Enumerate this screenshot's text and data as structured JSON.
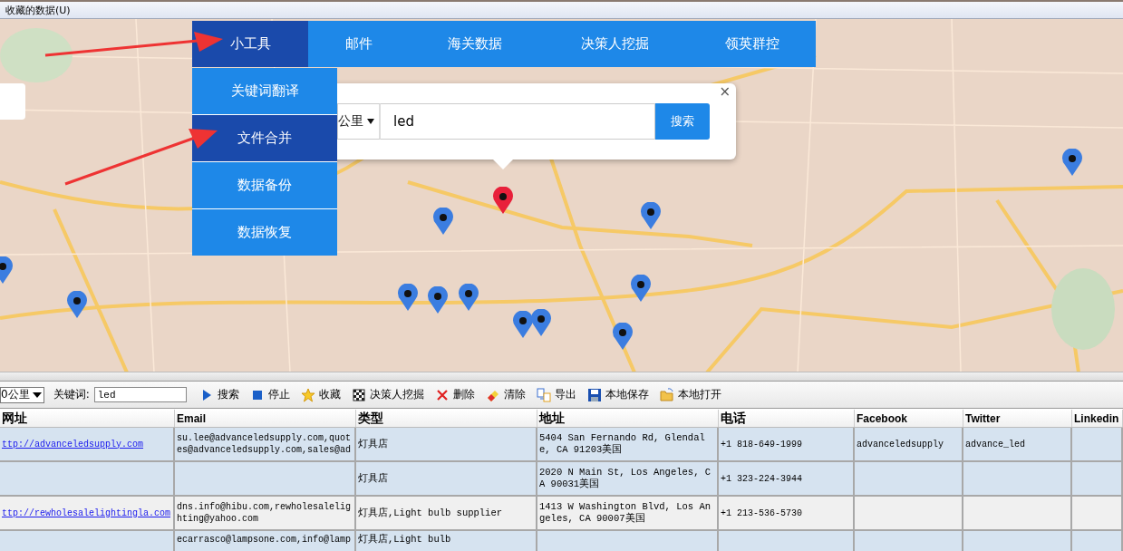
{
  "menu_bar": {
    "title": "收藏的数据(U)"
  },
  "nav_tabs": [
    {
      "label": "小工具",
      "selected": true
    },
    {
      "label": "邮件",
      "selected": false
    },
    {
      "label": "海关数据",
      "selected": false
    },
    {
      "label": "决策人挖掘",
      "selected": false
    },
    {
      "label": "领英群控",
      "selected": false
    }
  ],
  "tool_menu": [
    {
      "label": "关键词翻译",
      "selected": false
    },
    {
      "label": "文件合并",
      "selected": true
    },
    {
      "label": "数据备份",
      "selected": false
    },
    {
      "label": "数据恢复",
      "selected": false
    }
  ],
  "map_popup": {
    "distance": "公里",
    "keyword": "led",
    "search_button": "搜索",
    "close": "×"
  },
  "map_markers": [
    {
      "color": "#e8203a"
    },
    {
      "color": "#3b7de0"
    },
    {
      "color": "#3b7de0"
    },
    {
      "color": "#3b7de0"
    },
    {
      "color": "#3b7de0"
    },
    {
      "color": "#3b7de0"
    },
    {
      "color": "#3b7de0"
    },
    {
      "color": "#3b7de0"
    },
    {
      "color": "#3b7de0"
    },
    {
      "color": "#3b7de0"
    },
    {
      "color": "#3b7de0"
    },
    {
      "color": "#3b7de0"
    },
    {
      "color": "#3b7de0"
    }
  ],
  "toolbar": {
    "distance": "0公里",
    "keyword_label": "关键词:",
    "keyword": "led",
    "buttons": [
      {
        "kind": "play",
        "label": "搜索"
      },
      {
        "kind": "stop",
        "label": "停止"
      },
      {
        "kind": "star",
        "label": "收藏"
      },
      {
        "kind": "flag",
        "label": "决策人挖掘"
      },
      {
        "kind": "cross",
        "label": "删除"
      },
      {
        "kind": "eraser",
        "label": "清除"
      },
      {
        "kind": "export",
        "label": "导出"
      },
      {
        "kind": "disk",
        "label": "本地保存"
      },
      {
        "kind": "folder",
        "label": "本地打开"
      }
    ]
  },
  "table": {
    "columns": [
      "网址",
      "Email",
      "类型",
      "地址",
      "电话",
      "Facebook",
      "Twitter",
      "Linkedin"
    ],
    "rows": [
      {
        "website": "ttp://advanceledsupply.com",
        "email": "su.lee@advanceledsupply.com,quotes@advanceledsupply.com,sales@ad",
        "type": "灯具店",
        "address": "5404 San Fernando Rd, Glendale, CA 91203美国",
        "phone": "+1 818-649-1999",
        "facebook": "advanceledsupply",
        "twitter": "advance_led",
        "linkedin": ""
      },
      {
        "website": "",
        "email": "",
        "type": "灯具店",
        "address": "2020 N Main St, Los Angeles, CA 90031美国",
        "phone": "+1 323-224-3944",
        "facebook": "",
        "twitter": "",
        "linkedin": ""
      },
      {
        "website": "ttp://rewholesalelightingla.com",
        "email": "dns.info@hibu.com,rewholesalelighting@yahoo.com",
        "type": "灯具店,Light bulb supplier",
        "address": "1413 W Washington Blvd, Los Angeles, CA 90007美国",
        "phone": "+1 213-536-5730",
        "facebook": "",
        "twitter": "",
        "linkedin": ""
      },
      {
        "website": "",
        "email": "ecarrasco@lampsone.com,info@lamp",
        "type": "灯具店,Light bulb",
        "address": "",
        "phone": "",
        "facebook": "",
        "twitter": "",
        "linkedin": ""
      }
    ]
  }
}
